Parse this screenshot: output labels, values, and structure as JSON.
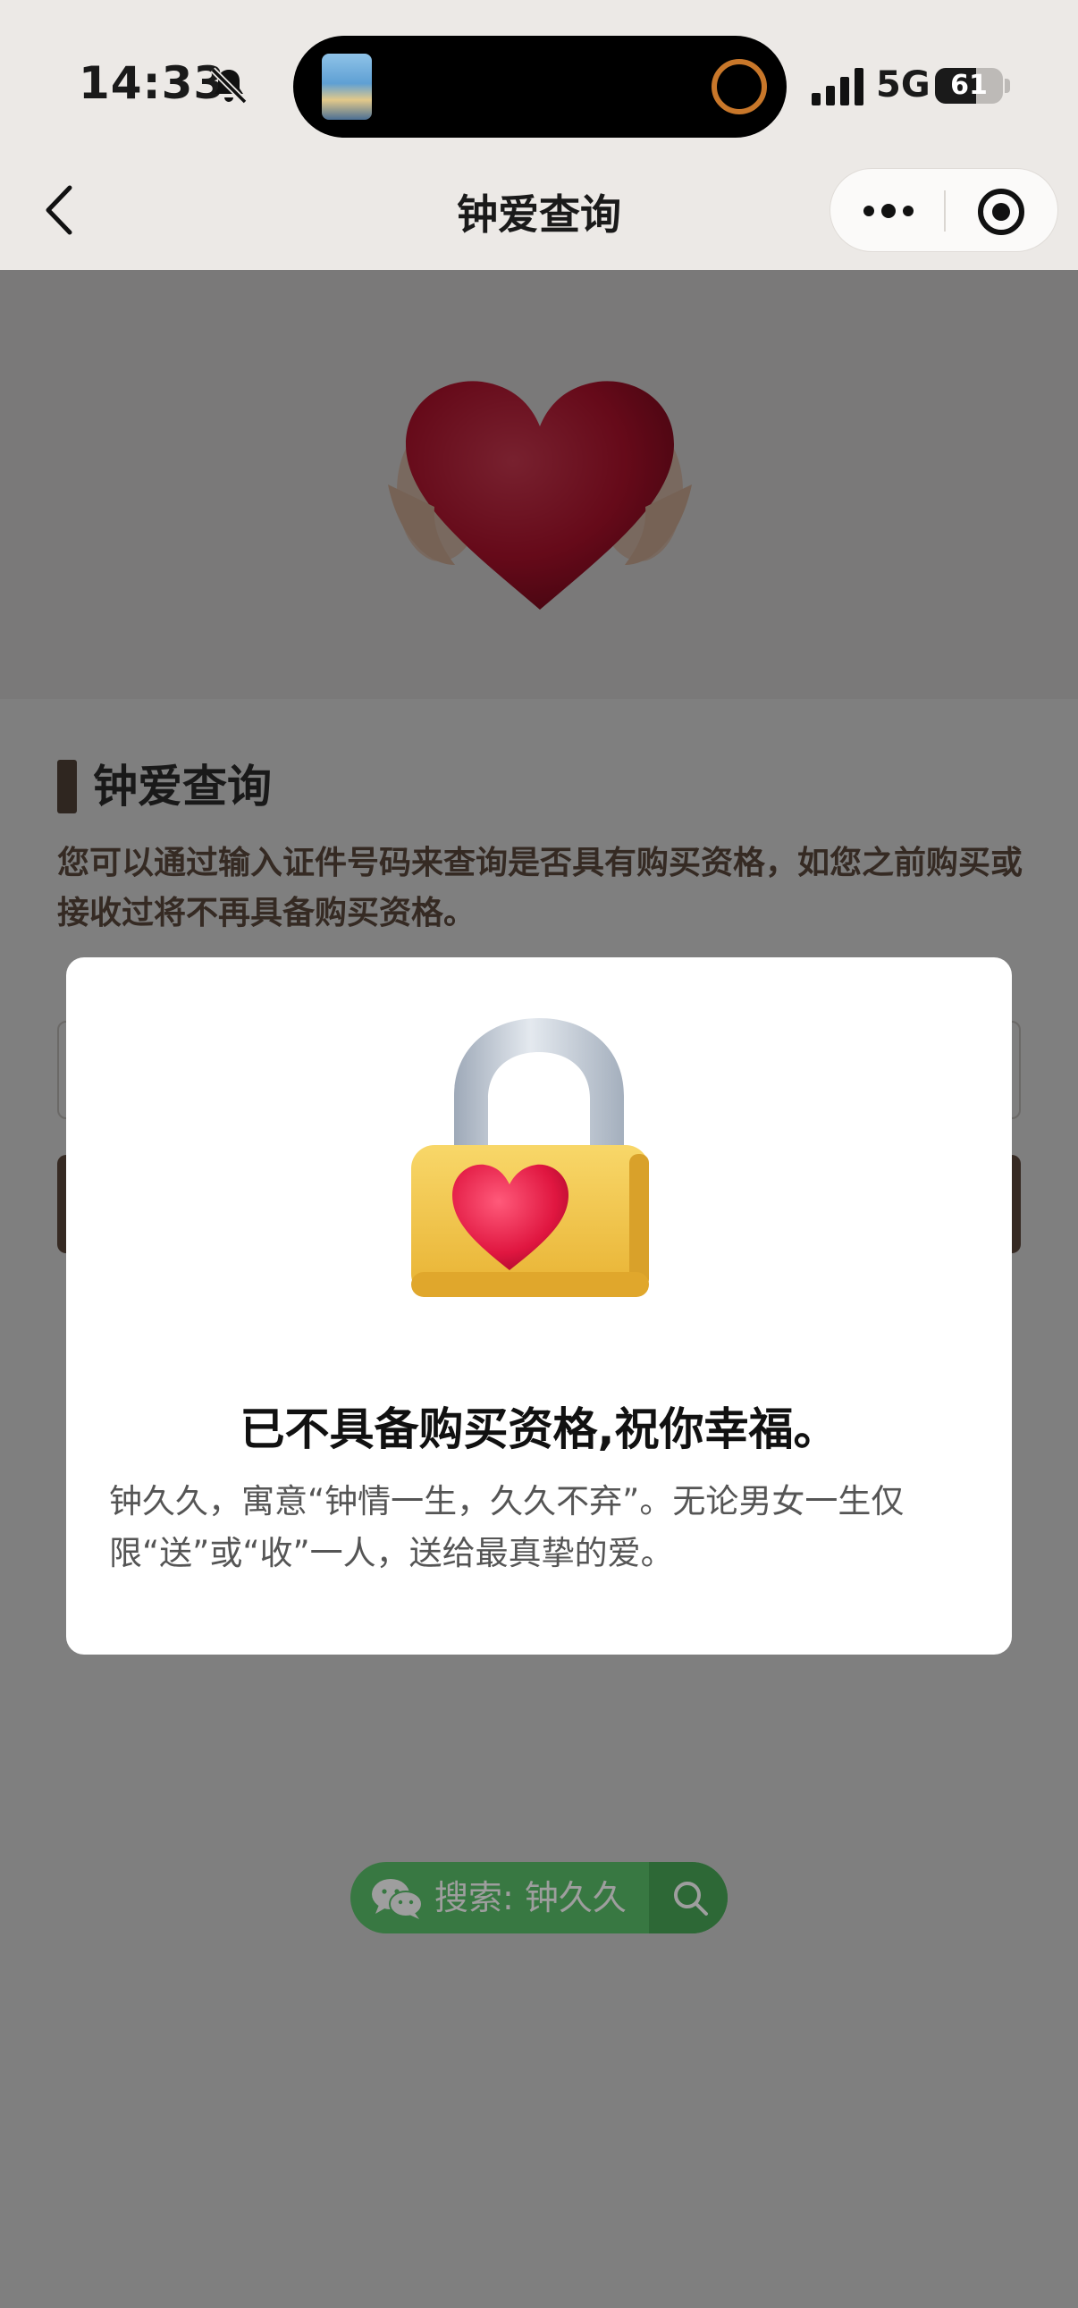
{
  "status_bar": {
    "time": "14:33",
    "network": "5G",
    "battery_level": "61",
    "battery_fraction": 0.61
  },
  "nav": {
    "title": "钟爱查询",
    "back_icon": "chevron-left-icon",
    "more_icon": "more-dots-icon",
    "close_icon": "target-circle-icon"
  },
  "page": {
    "section_title": "钟爱查询",
    "description": "您可以通过输入证件号码来查询是否具有购买资格，如您之前购买或接收过将不再具备购买资格。",
    "notice_title": "",
    "notice_text": "",
    "query_button": ""
  },
  "modal": {
    "title": "已不具备购买资格,祝你幸福。",
    "text": "钟久久，寓意“钟情一生，久久不弃”。无论男女一生仅限“送”或“收”一人，送给最真挚的爱。"
  },
  "search_bar": {
    "text": "搜索: 钟久久",
    "icon": "wechat-icon"
  },
  "colors": {
    "accent_brown": "#6d5446",
    "wechat_green": "#5bc16a",
    "heart_red": "#d3183a",
    "lock_yellow": "#f2c64a"
  }
}
